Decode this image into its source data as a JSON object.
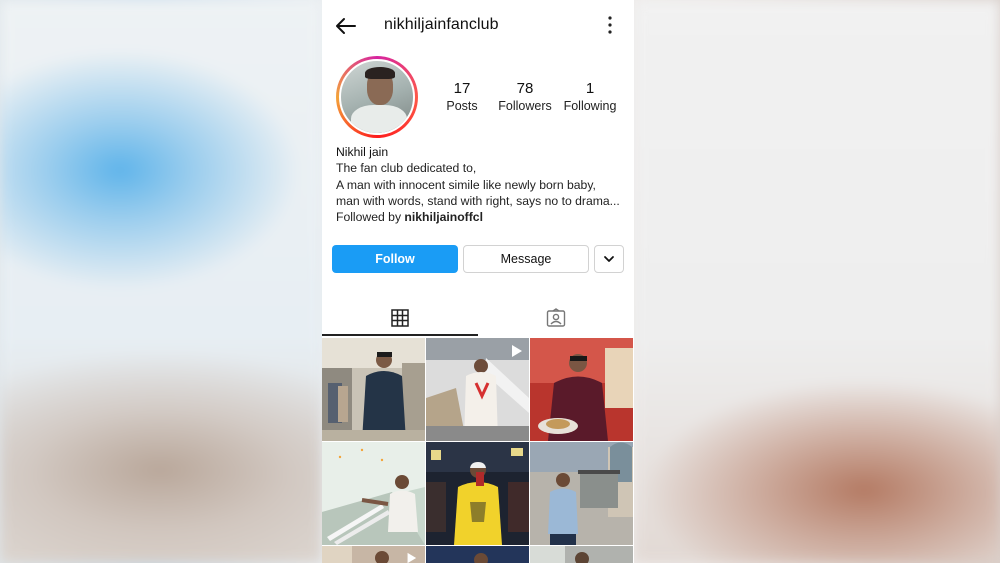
{
  "profile": {
    "username": "nikhiljainfanclub",
    "display_name": "Nikhil jain",
    "stats": [
      {
        "value": "17",
        "label": "Posts"
      },
      {
        "value": "78",
        "label": "Followers"
      },
      {
        "value": "1",
        "label": "Following"
      }
    ],
    "bio_lines": [
      "The fan club dedicated to,",
      "A man with innocent simile like newly born baby,",
      "man with words, stand with right, says no to drama..."
    ],
    "followed_by_prefix": "Followed by ",
    "followed_by_user": "nikhiljainoffcl"
  },
  "actions": {
    "follow_label": "Follow",
    "message_label": "Message"
  },
  "tabs": [
    {
      "icon": "grid-icon",
      "active": true
    },
    {
      "icon": "tagged-icon",
      "active": false
    }
  ],
  "grid_posts": [
    {
      "type": "photo",
      "scene": "street-market"
    },
    {
      "type": "video",
      "scene": "mall-escalator"
    },
    {
      "type": "photo",
      "scene": "restaurant"
    },
    {
      "type": "photo",
      "scene": "stairs-light"
    },
    {
      "type": "photo",
      "scene": "gym-selfie"
    },
    {
      "type": "photo",
      "scene": "rickshaw-gate"
    },
    {
      "type": "video",
      "scene": "partial-row"
    },
    {
      "type": "photo",
      "scene": "partial-row"
    },
    {
      "type": "photo",
      "scene": "partial-row"
    }
  ],
  "colors": {
    "accent": "#1a9cf5",
    "text": "#111111",
    "border": "#d2d2d2"
  }
}
